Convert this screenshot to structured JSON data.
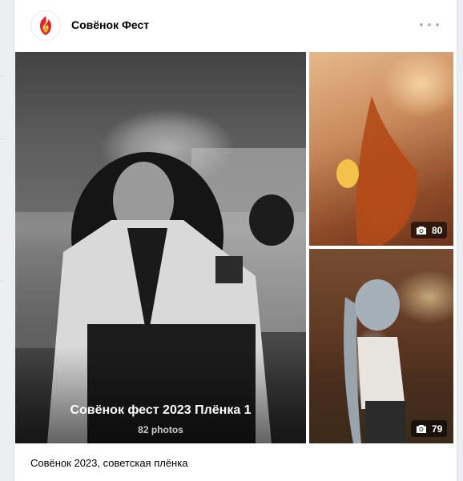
{
  "post": {
    "group_name": "Совёнок Фест",
    "avatar_icon": "flame-logo-icon",
    "more_icon": "more-dots-icon",
    "caption": "Совёнок 2023, советская плёнка"
  },
  "album": {
    "title": "Совёнок фест 2023 Плёнка 1",
    "count_label": "82 photos"
  },
  "photos": [
    {
      "count": "80",
      "icon": "camera-icon"
    },
    {
      "count": "79",
      "icon": "camera-icon"
    }
  ],
  "colors": {
    "card_bg": "#ffffff",
    "page_bg": "#edeef0",
    "brand_red": "#e0252a",
    "muted": "#aeb7c2"
  }
}
